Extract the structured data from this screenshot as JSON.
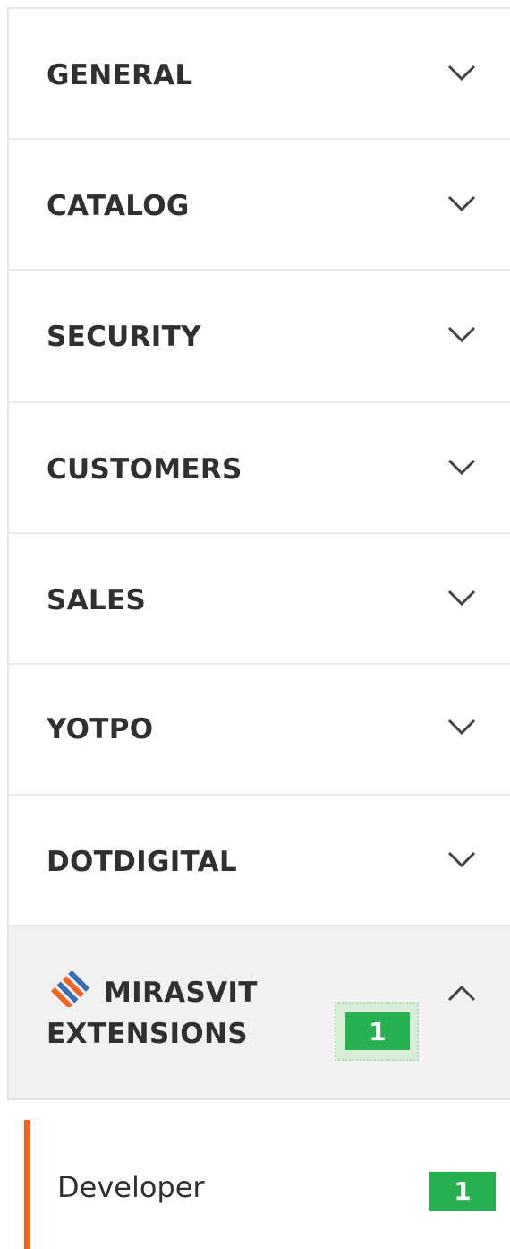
{
  "sections": [
    {
      "label": "GENERAL",
      "expanded": false
    },
    {
      "label": "CATALOG",
      "expanded": false
    },
    {
      "label": "SECURITY",
      "expanded": false
    },
    {
      "label": "CUSTOMERS",
      "expanded": false
    },
    {
      "label": "SALES",
      "expanded": false
    },
    {
      "label": "YOTPO",
      "expanded": false
    },
    {
      "label": "DOTDIGITAL",
      "expanded": false
    }
  ],
  "mirasvit": {
    "label_line1": "MIRASVIT",
    "label_line2": "EXTENSIONS",
    "badge_count": "1",
    "expanded": true,
    "logo_icon": "mirasvit-logo-icon",
    "items": [
      {
        "label": "Developer",
        "badge_count": "1"
      }
    ]
  },
  "colors": {
    "accent": "#f26322",
    "badge": "#27b04f",
    "text": "#303030",
    "active_bg": "#f1f1f1"
  },
  "icons": {
    "collapsed": "chevron-down-icon",
    "expanded": "chevron-up-icon"
  }
}
